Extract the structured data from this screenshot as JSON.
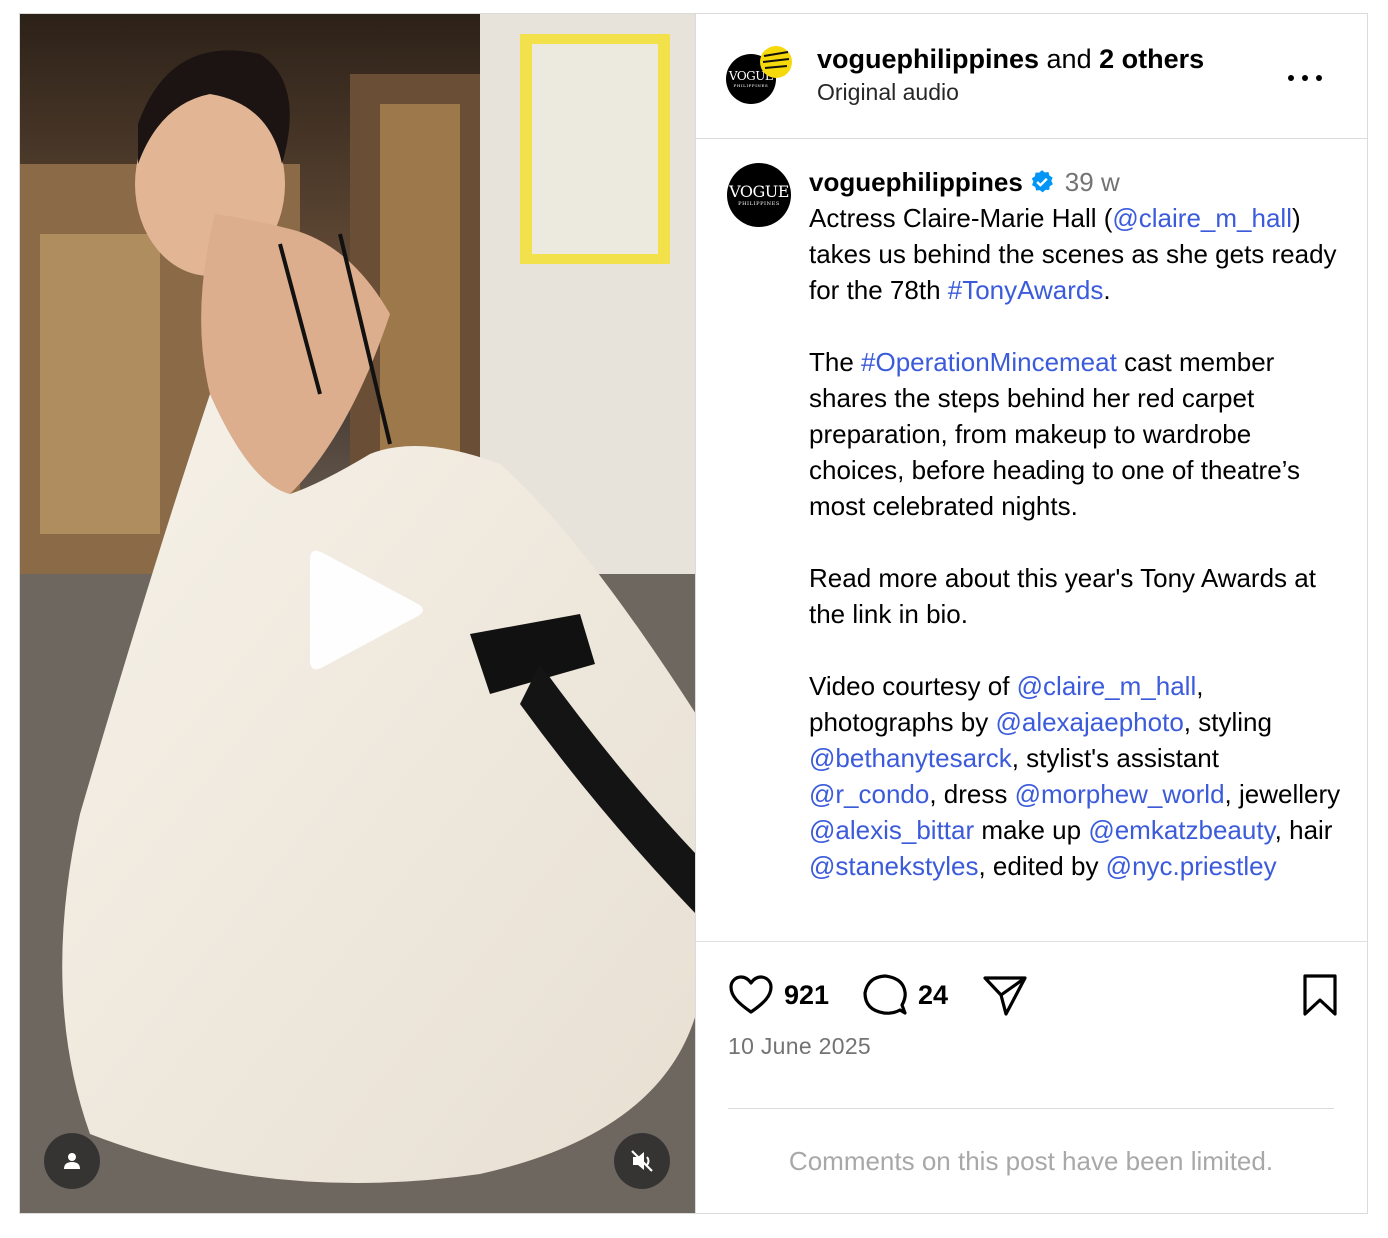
{
  "header": {
    "username": "voguephilippines",
    "and_text": "and",
    "others": "2 others",
    "audio": "Original audio",
    "avatar_logo": "VOGUE",
    "avatar_sub": "PHILIPPINES"
  },
  "caption": {
    "username": "voguephilippines",
    "time": "39 w",
    "p1": {
      "t1": "Actress Claire-Marie Hall (",
      "mention": "@claire_m_hall",
      "t2": ") takes us behind the scenes as she gets ready for the 78th ",
      "hashtag": "#TonyAwards",
      "t3": "."
    },
    "p2": {
      "t1": "The ",
      "hashtag": "#OperationMincemeat",
      "t2": " cast member shares the steps behind her red carpet preparation, from makeup to wardrobe choices, before heading to one of theatre’s most celebrated nights."
    },
    "p3": "Read more about this year's Tony Awards at the link in bio.",
    "p4": {
      "t1": "Video courtesy of ",
      "m1": "@claire_m_hall",
      "t2": ", photographs by ",
      "m2": "@alexajaephoto",
      "t3": ", styling ",
      "m3": "@bethanytesarck",
      "t4": ", stylist's assistant ",
      "m4": "@r_condo",
      "t5": ", dress ",
      "m5": "@morphew_world",
      "t6": ", jewellery ",
      "m6": "@alexis_bittar",
      "t7": " make up ",
      "m7": "@emkatzbeauty",
      "t8": ", hair ",
      "m8": "@stanekstyles",
      "t9": ", edited by ",
      "m9": "@nyc.priestley"
    }
  },
  "actions": {
    "likes": "921",
    "comments": "24"
  },
  "date": "10 June 2025",
  "comments_limited": "Comments on this post have been limited.",
  "colors": {
    "link": "#3b5bdb",
    "verified": "#0095f6",
    "muted_text": "#737373",
    "border": "#dbdbdb",
    "story_ring": "#f5d90a"
  },
  "icons": [
    "play-icon",
    "tag-person-icon",
    "mute-icon",
    "more-icon",
    "verified-badge-icon",
    "heart-icon",
    "comment-icon",
    "share-icon",
    "bookmark-icon"
  ]
}
